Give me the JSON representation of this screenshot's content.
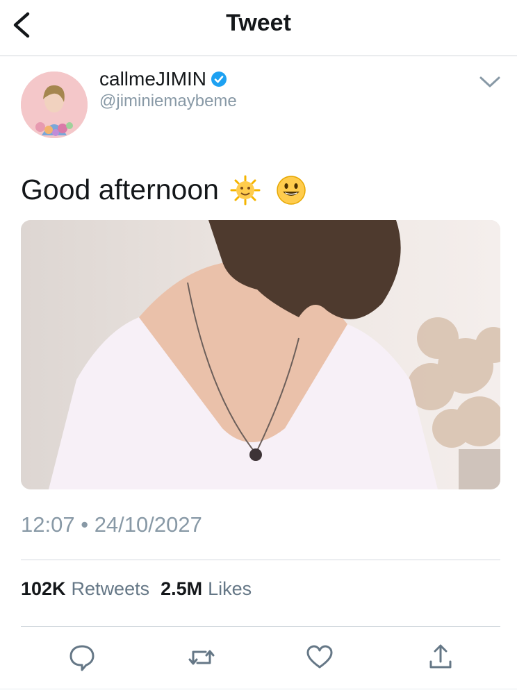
{
  "header": {
    "title": "Tweet"
  },
  "author": {
    "display_name": "callmeJIMIN",
    "handle": "@jiminiemaybeme",
    "verified": true
  },
  "tweet": {
    "text": "Good afternoon",
    "emojis": [
      "sun-with-face",
      "smiling-face"
    ],
    "media": "photo"
  },
  "meta": {
    "time": "12:07",
    "separator": "•",
    "date": "24/10/2027"
  },
  "stats": {
    "retweets_count": "102K",
    "retweets_label": "Retweets",
    "likes_count": "2.5M",
    "likes_label": "Likes"
  },
  "actions": [
    "reply-icon",
    "retweet-icon",
    "like-icon",
    "share-icon"
  ],
  "colors": {
    "accent": "#1da1f2",
    "secondary_text": "#8899a6",
    "icon": "#657786"
  }
}
